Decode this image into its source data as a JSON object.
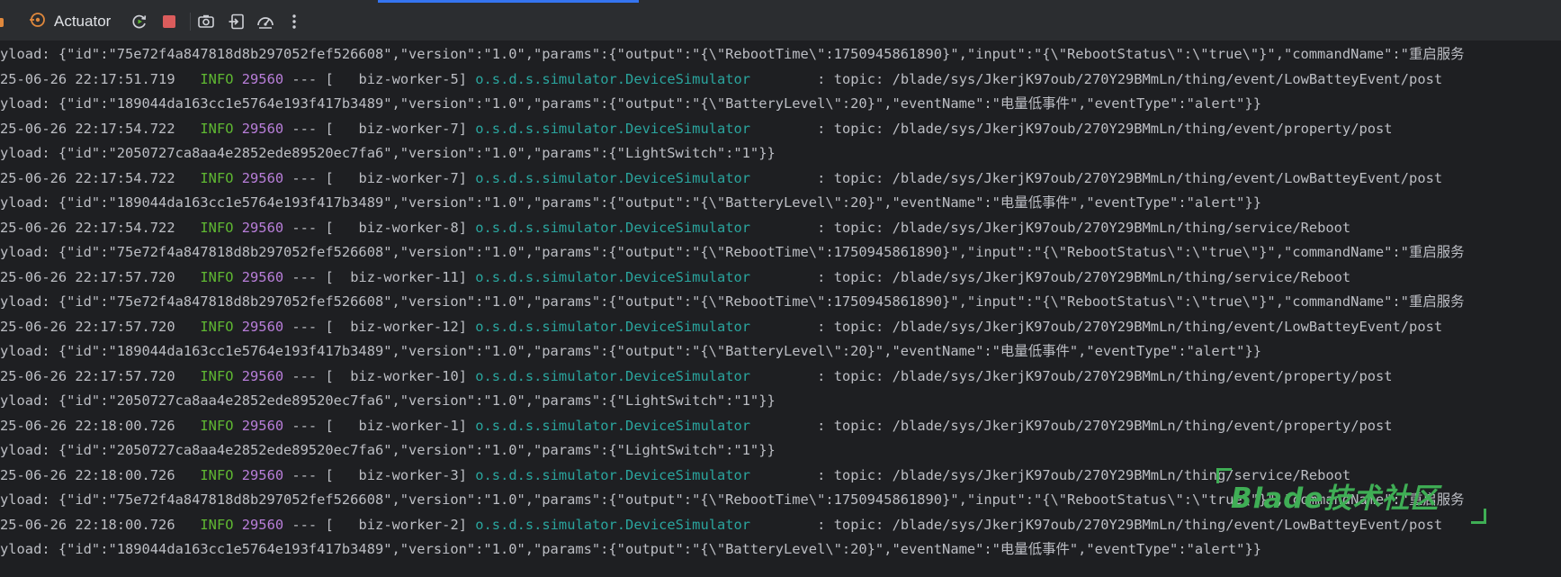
{
  "toolbar": {
    "tab_label": "Actuator",
    "icons": [
      "actuator-icon",
      "rerun-icon",
      "stop-icon",
      "camera-icon",
      "login-icon",
      "gauge-icon",
      "more-vertical-icon"
    ]
  },
  "colors": {
    "level": "#5fb832",
    "pid": "#b87ed9",
    "logger": "#2aa59e",
    "text": "#bcbec4",
    "watermark": "#3fae55"
  },
  "log": {
    "lines": [
      {
        "type": "payload",
        "text": "yload: {\"id\":\"75e72f4a847818d8b297052fef526608\",\"version\":\"1.0\",\"params\":{\"output\":\"{\\\"RebootTime\\\":1750945861890}\",\"input\":\"{\\\"RebootStatus\\\":\\\"true\\\"}\",\"commandName\":\"重启服务"
      },
      {
        "type": "entry",
        "ts": "25-06-26 22:17:51.719",
        "level": " INFO",
        "pid": "29560",
        "sep": " --- [",
        "thread": "   biz-worker-5]",
        "logger": "o.s.d.s.simulator.DeviceSimulator",
        "msg": "        : topic: /blade/sys/JkerjK97oub/270Y29BMmLn/thing/event/LowBatteyEvent/post"
      },
      {
        "type": "payload",
        "text": "yload: {\"id\":\"189044da163cc1e5764e193f417b3489\",\"version\":\"1.0\",\"params\":{\"output\":\"{\\\"BatteryLevel\\\":20}\",\"eventName\":\"电量低事件\",\"eventType\":\"alert\"}}"
      },
      {
        "type": "entry",
        "ts": "25-06-26 22:17:54.722",
        "level": " INFO",
        "pid": "29560",
        "sep": " --- [",
        "thread": "   biz-worker-7]",
        "logger": "o.s.d.s.simulator.DeviceSimulator",
        "msg": "        : topic: /blade/sys/JkerjK97oub/270Y29BMmLn/thing/event/property/post"
      },
      {
        "type": "payload",
        "text": "yload: {\"id\":\"2050727ca8aa4e2852ede89520ec7fa6\",\"version\":\"1.0\",\"params\":{\"LightSwitch\":\"1\"}}"
      },
      {
        "type": "entry",
        "ts": "25-06-26 22:17:54.722",
        "level": " INFO",
        "pid": "29560",
        "sep": " --- [",
        "thread": "   biz-worker-7]",
        "logger": "o.s.d.s.simulator.DeviceSimulator",
        "msg": "        : topic: /blade/sys/JkerjK97oub/270Y29BMmLn/thing/event/LowBatteyEvent/post"
      },
      {
        "type": "payload",
        "text": "yload: {\"id\":\"189044da163cc1e5764e193f417b3489\",\"version\":\"1.0\",\"params\":{\"output\":\"{\\\"BatteryLevel\\\":20}\",\"eventName\":\"电量低事件\",\"eventType\":\"alert\"}}"
      },
      {
        "type": "entry",
        "ts": "25-06-26 22:17:54.722",
        "level": " INFO",
        "pid": "29560",
        "sep": " --- [",
        "thread": "   biz-worker-8]",
        "logger": "o.s.d.s.simulator.DeviceSimulator",
        "msg": "        : topic: /blade/sys/JkerjK97oub/270Y29BMmLn/thing/service/Reboot"
      },
      {
        "type": "payload",
        "text": "yload: {\"id\":\"75e72f4a847818d8b297052fef526608\",\"version\":\"1.0\",\"params\":{\"output\":\"{\\\"RebootTime\\\":1750945861890}\",\"input\":\"{\\\"RebootStatus\\\":\\\"true\\\"}\",\"commandName\":\"重启服务"
      },
      {
        "type": "entry",
        "ts": "25-06-26 22:17:57.720",
        "level": " INFO",
        "pid": "29560",
        "sep": " --- [",
        "thread": "  biz-worker-11]",
        "logger": "o.s.d.s.simulator.DeviceSimulator",
        "msg": "        : topic: /blade/sys/JkerjK97oub/270Y29BMmLn/thing/service/Reboot"
      },
      {
        "type": "payload",
        "text": "yload: {\"id\":\"75e72f4a847818d8b297052fef526608\",\"version\":\"1.0\",\"params\":{\"output\":\"{\\\"RebootTime\\\":1750945861890}\",\"input\":\"{\\\"RebootStatus\\\":\\\"true\\\"}\",\"commandName\":\"重启服务"
      },
      {
        "type": "entry",
        "ts": "25-06-26 22:17:57.720",
        "level": " INFO",
        "pid": "29560",
        "sep": " --- [",
        "thread": "  biz-worker-12]",
        "logger": "o.s.d.s.simulator.DeviceSimulator",
        "msg": "        : topic: /blade/sys/JkerjK97oub/270Y29BMmLn/thing/event/LowBatteyEvent/post"
      },
      {
        "type": "payload",
        "text": "yload: {\"id\":\"189044da163cc1e5764e193f417b3489\",\"version\":\"1.0\",\"params\":{\"output\":\"{\\\"BatteryLevel\\\":20}\",\"eventName\":\"电量低事件\",\"eventType\":\"alert\"}}"
      },
      {
        "type": "entry",
        "ts": "25-06-26 22:17:57.720",
        "level": " INFO",
        "pid": "29560",
        "sep": " --- [",
        "thread": "  biz-worker-10]",
        "logger": "o.s.d.s.simulator.DeviceSimulator",
        "msg": "        : topic: /blade/sys/JkerjK97oub/270Y29BMmLn/thing/event/property/post"
      },
      {
        "type": "payload",
        "text": "yload: {\"id\":\"2050727ca8aa4e2852ede89520ec7fa6\",\"version\":\"1.0\",\"params\":{\"LightSwitch\":\"1\"}}"
      },
      {
        "type": "entry",
        "ts": "25-06-26 22:18:00.726",
        "level": " INFO",
        "pid": "29560",
        "sep": " --- [",
        "thread": "   biz-worker-1]",
        "logger": "o.s.d.s.simulator.DeviceSimulator",
        "msg": "        : topic: /blade/sys/JkerjK97oub/270Y29BMmLn/thing/event/property/post"
      },
      {
        "type": "payload",
        "text": "yload: {\"id\":\"2050727ca8aa4e2852ede89520ec7fa6\",\"version\":\"1.0\",\"params\":{\"LightSwitch\":\"1\"}}"
      },
      {
        "type": "entry",
        "ts": "25-06-26 22:18:00.726",
        "level": " INFO",
        "pid": "29560",
        "sep": " --- [",
        "thread": "   biz-worker-3]",
        "logger": "o.s.d.s.simulator.DeviceSimulator",
        "msg": "        : topic: /blade/sys/JkerjK97oub/270Y29BMmLn/thing/service/Reboot"
      },
      {
        "type": "payload",
        "text": "yload: {\"id\":\"75e72f4a847818d8b297052fef526608\",\"version\":\"1.0\",\"params\":{\"output\":\"{\\\"RebootTime\\\":1750945861890}\",\"input\":\"{\\\"RebootStatus\\\":\\\"true\\\"}\",\"commandName\":\"重启服务"
      },
      {
        "type": "entry",
        "ts": "25-06-26 22:18:00.726",
        "level": " INFO",
        "pid": "29560",
        "sep": " --- [",
        "thread": "   biz-worker-2]",
        "logger": "o.s.d.s.simulator.DeviceSimulator",
        "msg": "        : topic: /blade/sys/JkerjK97oub/270Y29BMmLn/thing/event/LowBatteyEvent/post"
      },
      {
        "type": "payload",
        "text": "yload: {\"id\":\"189044da163cc1e5764e193f417b3489\",\"version\":\"1.0\",\"params\":{\"output\":\"{\\\"BatteryLevel\\\":20}\",\"eventName\":\"电量低事件\",\"eventType\":\"alert\"}}"
      }
    ]
  },
  "watermark": {
    "text": "Blade技术社区"
  }
}
